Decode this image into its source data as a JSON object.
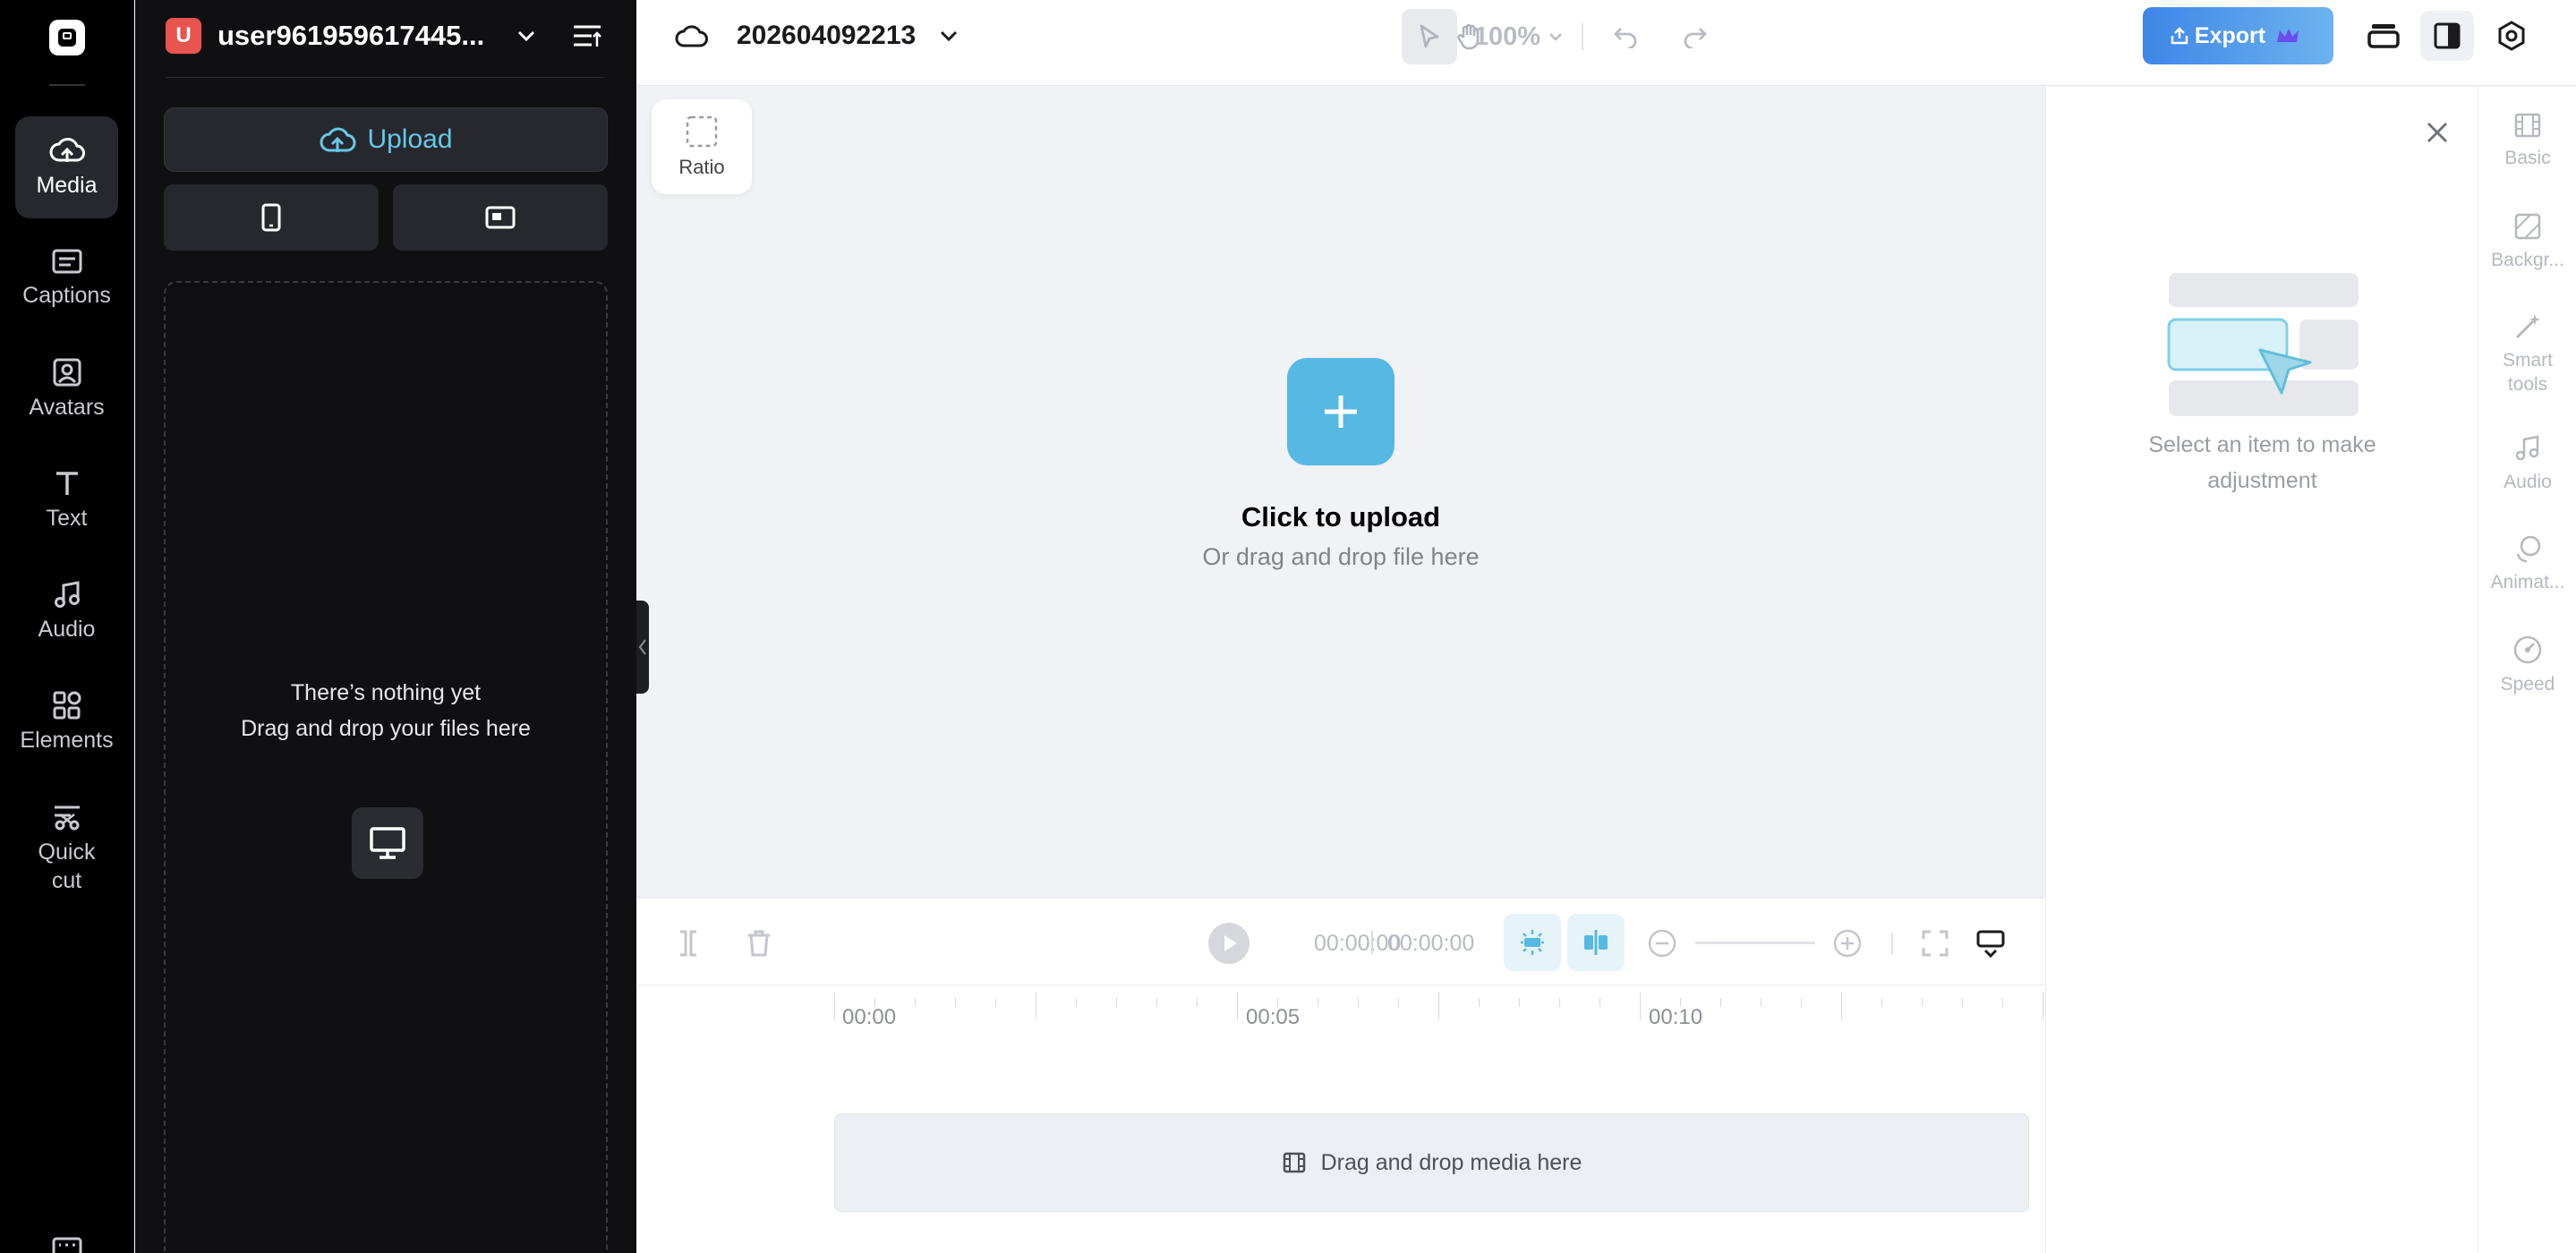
{
  "sidebar": {
    "items": [
      {
        "label": "Media",
        "icon": "cloud-upload-icon",
        "active": true
      },
      {
        "label": "Captions",
        "icon": "captions-icon"
      },
      {
        "label": "Avatars",
        "icon": "avatar-icon"
      },
      {
        "label": "Text",
        "icon": "text-icon"
      },
      {
        "label": "Audio",
        "icon": "music-note-icon"
      },
      {
        "label": "Elements",
        "icon": "elements-icon"
      },
      {
        "label": "Quick cut",
        "icon": "quick-cut-icon"
      }
    ]
  },
  "panel": {
    "avatar_letter": "U",
    "username": "user961959617445...",
    "upload_label": "Upload",
    "empty_title": "There’s nothing yet",
    "empty_subtitle": "Drag and drop your files here"
  },
  "topbar": {
    "project_name": "202604092213",
    "zoom": "100%",
    "export_label": "Export"
  },
  "canvas": {
    "ratio_label": "Ratio",
    "upload_title": "Click to upload",
    "upload_subtitle": "Or drag and drop file here"
  },
  "timeline": {
    "current_time": "00:00:00",
    "total_time": "00:00:00",
    "ruler_labels": [
      "00:00",
      "00:05",
      "00:10"
    ],
    "drop_label": "Drag and drop media here"
  },
  "properties": {
    "empty_message": "Select an item to make adjustment"
  },
  "tabs": {
    "items": [
      {
        "label": "Basic"
      },
      {
        "label": "Backgr..."
      },
      {
        "label": "Smart tools"
      },
      {
        "label": "Audio"
      },
      {
        "label": "Animat..."
      },
      {
        "label": "Speed"
      }
    ]
  },
  "colors": {
    "accent": "#55b9e3",
    "export_gradient_start": "#3e86e8",
    "export_gradient_end": "#6cb3ee",
    "avatar": "#e8554e",
    "dark_panel": "#101012"
  }
}
